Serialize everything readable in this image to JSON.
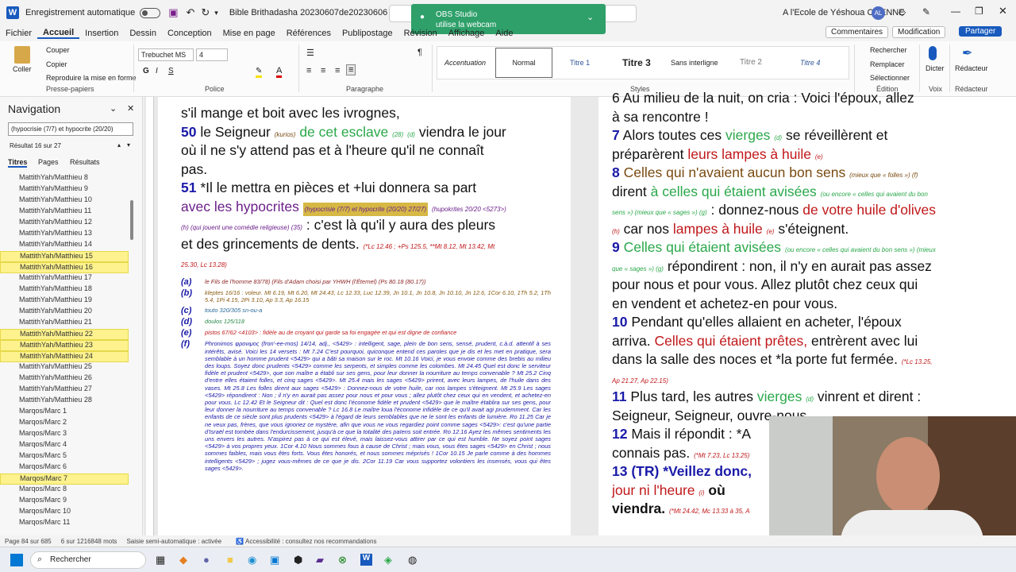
{
  "titlebar": {
    "autosave": "Enregistrement automatique",
    "doc_title": "Bible Brithadasha 20230607de20230606",
    "user": "A l'Ecole de Yéshoua COENNE",
    "avatar": "AL"
  },
  "toast": {
    "title": "OBS Studio",
    "body": "utilise la webcam"
  },
  "menu": [
    "Fichier",
    "Accueil",
    "Insertion",
    "Dessin",
    "Conception",
    "Mise en page",
    "Références",
    "Publipostage",
    "Révision",
    "Affichage",
    "Aide"
  ],
  "menu_right": {
    "comments": "Commentaires",
    "edit": "Modification",
    "share": "Partager"
  },
  "ribbon": {
    "clipboard": {
      "paste": "Coller",
      "cut": "Couper",
      "copy": "Copier",
      "format": "Reproduire la mise en forme",
      "label": "Presse-papiers"
    },
    "font": {
      "name": "Trebuchet MS",
      "size": "4",
      "label": "Police"
    },
    "paragraph": {
      "label": "Paragraphe"
    },
    "styles": {
      "items": [
        "Accentuation",
        "Normal",
        "Titre 1",
        "Titre 3",
        "Sans interligne",
        "Titre 2",
        "Titre 4"
      ],
      "label": "Styles"
    },
    "editing": {
      "find": "Rechercher",
      "replace": "Remplacer",
      "select": "Sélectionner",
      "label": "Édition"
    },
    "voice": {
      "dictate": "Dicter",
      "label": "Voix"
    },
    "editor": {
      "btn": "Rédacteur",
      "label": "Rédacteur"
    }
  },
  "nav": {
    "title": "Navigation",
    "search": "(hypocrisie (7/7) et hypocrite (20/20)",
    "results_count": "Résultat 16 sur 27",
    "tabs": [
      "Titres",
      "Pages",
      "Résultats"
    ],
    "items": [
      {
        "label": "MattithYah/Matthieu 8",
        "hl": false
      },
      {
        "label": "MattithYah/Matthieu 9",
        "hl": false
      },
      {
        "label": "MattithYah/Matthieu 10",
        "hl": false
      },
      {
        "label": "MattithYah/Matthieu 11",
        "hl": false
      },
      {
        "label": "MattithYah/Matthieu 12",
        "hl": false
      },
      {
        "label": "MattithYah/Matthieu 13",
        "hl": false
      },
      {
        "label": "MattithYah/Matthieu 14",
        "hl": false
      },
      {
        "label": "MattithYah/Matthieu 15",
        "hl": true
      },
      {
        "label": "MattithYah/Matthieu 16",
        "hl": true
      },
      {
        "label": "MattithYah/Matthieu 17",
        "hl": false
      },
      {
        "label": "MattithYah/Matthieu 18",
        "hl": false
      },
      {
        "label": "MattithYah/Matthieu 19",
        "hl": false
      },
      {
        "label": "MattithYah/Matthieu 20",
        "hl": false
      },
      {
        "label": "MattithYah/Matthieu 21",
        "hl": false
      },
      {
        "label": "MattithYah/Matthieu 22",
        "hl": true
      },
      {
        "label": "MattithYah/Matthieu 23",
        "hl": true
      },
      {
        "label": "MattithYah/Matthieu 24",
        "hl": true
      },
      {
        "label": "MattithYah/Matthieu 25",
        "hl": false
      },
      {
        "label": "MattithYah/Matthieu 26",
        "hl": false
      },
      {
        "label": "MattithYah/Matthieu 27",
        "hl": false
      },
      {
        "label": "MattithYah/Matthieu 28",
        "hl": false
      },
      {
        "label": "Marqos/Marc 1",
        "hl": false
      },
      {
        "label": "Marqos/Marc 2",
        "hl": false
      },
      {
        "label": "Marqos/Marc 3",
        "hl": false
      },
      {
        "label": "Marqos/Marc 4",
        "hl": false
      },
      {
        "label": "Marqos/Marc 5",
        "hl": false
      },
      {
        "label": "Marqos/Marc 6",
        "hl": false
      },
      {
        "label": "Marqos/Marc 7",
        "hl": true
      },
      {
        "label": "Marqos/Marc 8",
        "hl": false
      },
      {
        "label": "Marqos/Marc 9",
        "hl": false
      },
      {
        "label": "Marqos/Marc 10",
        "hl": false
      },
      {
        "label": "Marqos/Marc 11",
        "hl": false
      }
    ]
  },
  "status": {
    "page": "Page 84 sur 685",
    "words": "6 sur 1216848 mots",
    "mode": "Saisie semi-automatique : activée",
    "access": "Accessibilité : consultez nos recommandations"
  },
  "taskbar": {
    "search": "Rechercher"
  },
  "left_page": {
    "l0": "s'il mange et boit avec les ivrognes,",
    "v50": "50",
    "v50a": "le Seigneur",
    "v50b": "(kurios)",
    "v50c": "de cet esclave",
    "v50d": "(28)",
    "v50e": "(d)",
    "v50f": "viendra le jour",
    "l2": "où il ne s'y attend pas et à l'heure qu'il ne connaît",
    "l3": "pas.",
    "v51": "51",
    "v51a": "*Il le mettra en pièces et +lui donnera sa part",
    "l5a": "avec les hypocrites",
    "l5b": "(hypocrisie (7/7) et hypocrite (20/20)  27/27)",
    "l5c": "(hupokrites 20/20 <5273>)",
    "l6a": "(h) (qui jouent une comédie religieuse)  (35)",
    "l6b": ": c'est là qu'il y aura des pleurs",
    "l7": "et des grincements de dents.",
    "l7ref": "(*Lc 12.46 ; +Ps 125.5, **Mt 8.12, Mt 13.42, Mt",
    "l8ref": "25.30, Lc 13.28)",
    "notes": [
      {
        "k": "(a)",
        "t": "le Fils de l'homme 83/78) (Fils d'Adam choisi par YHWH (l'Éternel)  (Ps 80.18 (80.17))"
      },
      {
        "k": "(b)",
        "t": "kleptes 16/16 : voleur.  Mt 6.19, Mt 6.20, Mt 24.43, Lc 12.33, Luc 12.39, Jn 10.1, Jn 10.8, Jn 10.10, Jn 12.6, 1Cor 6.10, 1Th 5.2, 1Th 5.4, 1Pi 4.15, 2Pi 3.10, Ap 3.3, Ap 16.15"
      },
      {
        "k": "(c)",
        "t": "touto 320/305 sn-ou-a"
      },
      {
        "k": "(d)",
        "t": "doulos 125/118"
      },
      {
        "k": "(e)",
        "t": "pistos 67/62 <4103> : fidèle au de croyant qui garde sa foi engagée et qui est digne de confiance"
      },
      {
        "k": "(f)",
        "t": "Phronimos  φρονιμος (fron'-ee-mos) 14/14, adj., <5429> : intelligent, sage, plein de bon sens, sensé, prudent, c.à.d. attentif à ses intérêts, avisé.  Voici les 14 versets : Mt 7.24 C'est pourquoi, quiconque entend ces paroles que je dis et les met en pratique, sera semblable à un homme prudent <5429> qui a bâti sa maison sur le roc. Mt 10.16 Voici, je vous envoie comme des brebis au milieu des loups. Soyez donc prudents <5429> comme les serpents, et simples comme les colombes. Mt 24.45 Quel est donc le serviteur fidèle et prudent <5429>, que son maître a établi sur ses gens, pour leur donner la nourriture au temps convenable ? Mt 25.2 Cinq d'entre elles étaient folles, et cinq sages <5429>. Mt 25.4 mais les sages <5429> prirent, avec leurs lampes, de l'huile dans des vases. Mt 25.8 Les folles dirent aux sages <5429> : Donnez-nous de votre huile, car nos lampes s'éteignent. Mt 25.9 Les sages <5429> répondirent : Non ; il n'y en aurait pas assez pour nous et pour vous ; allez plutôt chez ceux qui en vendent, et achetez-en pour vous. Lc 12.42 Et le Seigneur dit : Quel est donc l'économe fidèle et prudent <5429> que le maître établira sur ses gens, pour leur donner la nourriture au temps convenable ? Lc 16.8 Le maître loua l'économe infidèle de ce qu'il avait agi prudemment. Car les enfants de ce siècle sont plus prudents <5429> à l'égard de leurs semblables que ne le sont les enfants de lumière. Ro 11.25 Car je ne veux pas, frères, que vous ignoriez ce mystère, afin que vous ne vous regardiez point comme sages <5429>: c'est qu'une partie d'Israël est tombée dans l'endurcissement, jusqu'à ce que la totalité des païens soit entrée. Ro 12.16 Ayez les mêmes sentiments les uns envers les autres. N'aspirez pas à ce qui est élevé, mais laissez-vous attirer par ce qui est humble. Ne soyez point sages <5429> à vos propres yeux. 1Cor 4.10 Nous sommes fous à cause de Christ ; mais vous, vous êtes sages <5429> en Christ ; nous sommes faibles, mais vous êtes forts. Vous êtes honorés, et nous sommes méprisés ! 1Cor 10.15 Je parle comme à des hommes intelligents <5429> ; jugez vous-mêmes de ce que je dis. 2Cor 11.19 Car vous supportez volontiers les insensés, vous qui êtes sages <5429>."
      }
    ]
  },
  "right_page": {
    "l0": "6 Au milieu de la nuit, on cria : Voici l'époux, allez",
    "l1": "à sa rencontre !",
    "v7": "7",
    "v7a": "Alors toutes ces",
    "v7b": "vierges",
    "v7c": "(d)",
    "v7d": "se réveillèrent et",
    "l3a": "préparèrent",
    "l3b": "leurs lampes à huile",
    "l3c": "(e)",
    "v8": "8",
    "v8a": "Celles qui n'avaient aucun bon sens",
    "v8b": "(mieux que « folles ») (f)",
    "l5a": "dirent",
    "l5b": "à celles qui étaient avisées",
    "l5c": "(ou encore « celles qui avaient du bon",
    "l6a": "sens ») (mieux que « sages ») (g)",
    "l6b": ": donnez-nous",
    "l6c": "de votre huile d'olives",
    "l7a": "(h)",
    "l7b": "car nos",
    "l7c": "lampes à huile",
    "l7d": "(e)",
    "l7e": "s'éteignent.",
    "v9": "9",
    "v9a": "Celles qui étaient avisées",
    "v9b": "(ou encore « celles qui avaient du bon sens ») (mieux",
    "l9a": "que « sages ») (g)",
    "l9b": "répondirent : non, il n'y en aurait pas assez",
    "l10": "pour nous et pour vous. Allez plutôt chez ceux qui",
    "l11": "en vendent et achetez-en pour vous.",
    "v10": "10",
    "v10a": "Pendant qu'elles allaient en acheter, l'époux",
    "l13a": "arriva.",
    "l13b": "Celles qui étaient prêtes,",
    "l13c": "entrèrent avec lui",
    "l14a": "dans la salle des noces et *la porte fut fermée.",
    "l14b": "(*Lc 13.25,",
    "l15": "Ap 21.27, Ap 22.15)",
    "v11": "11",
    "v11a": "Plus tard, les autres",
    "v11b": "vierges",
    "v11c": "(d)",
    "v11d": "vinrent et dirent :",
    "l17": "Seigneur, Seigneur, ouvre-nous.",
    "v12": "12",
    "v12a": "Mais il répondit : *A",
    "l19a": "connais pas.",
    "l19b": "(*Mt 7.23, Lc 13.25)",
    "v13": "13 (TR)",
    "v13a": "*Veillez donc,",
    "l21a": "jour ni l'heure",
    "l21b": "(i)",
    "l21c": "où",
    "l22a": "viendra.",
    "l22b": "(*Mt 24.42, Mc 13.33 à 35, A"
  }
}
